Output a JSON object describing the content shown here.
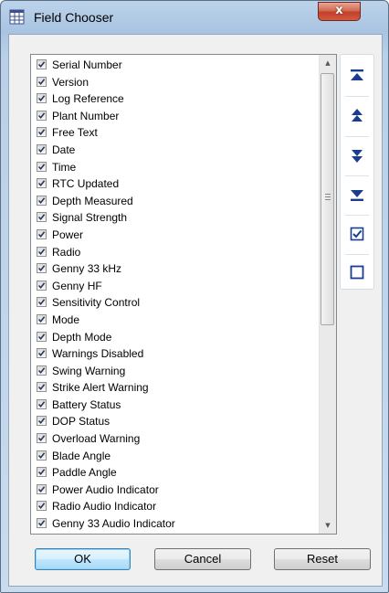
{
  "window": {
    "title": "Field Chooser",
    "close_label": "x"
  },
  "fields": [
    {
      "label": "Serial Number",
      "checked": true
    },
    {
      "label": "Version",
      "checked": true
    },
    {
      "label": "Log Reference",
      "checked": true
    },
    {
      "label": "Plant Number",
      "checked": true
    },
    {
      "label": "Free Text",
      "checked": true
    },
    {
      "label": "Date",
      "checked": true
    },
    {
      "label": "Time",
      "checked": true
    },
    {
      "label": "RTC Updated",
      "checked": true
    },
    {
      "label": "Depth Measured",
      "checked": true
    },
    {
      "label": "Signal Strength",
      "checked": true
    },
    {
      "label": "Power",
      "checked": true
    },
    {
      "label": "Radio",
      "checked": true
    },
    {
      "label": "Genny 33 kHz",
      "checked": true
    },
    {
      "label": "Genny HF",
      "checked": true
    },
    {
      "label": "Sensitivity Control",
      "checked": true
    },
    {
      "label": "Mode",
      "checked": true
    },
    {
      "label": "Depth Mode",
      "checked": true
    },
    {
      "label": "Warnings Disabled",
      "checked": true
    },
    {
      "label": "Swing Warning",
      "checked": true
    },
    {
      "label": "Strike Alert Warning",
      "checked": true
    },
    {
      "label": "Battery Status",
      "checked": true
    },
    {
      "label": "DOP Status",
      "checked": true
    },
    {
      "label": "Overload Warning",
      "checked": true
    },
    {
      "label": "Blade Angle",
      "checked": true
    },
    {
      "label": "Paddle Angle",
      "checked": true
    },
    {
      "label": "Power Audio Indicator",
      "checked": true
    },
    {
      "label": "Radio Audio Indicator",
      "checked": true
    },
    {
      "label": "Genny 33 Audio Indicator",
      "checked": true
    }
  ],
  "scrollbar": {
    "up_arrow": "▲",
    "down_arrow": "▼",
    "thumb_position": 0.0,
    "visible_fraction": 0.55
  },
  "toolbar": {
    "buttons": [
      {
        "icon": "move-to-top-icon"
      },
      {
        "icon": "move-up-icon"
      },
      {
        "icon": "move-down-icon"
      },
      {
        "icon": "move-to-bottom-icon"
      },
      {
        "icon": "check-all-icon"
      },
      {
        "icon": "uncheck-all-icon"
      }
    ],
    "icon_color": "#1a3d8f"
  },
  "buttons": {
    "ok_label": "OK",
    "cancel_label": "Cancel",
    "reset_label": "Reset"
  }
}
